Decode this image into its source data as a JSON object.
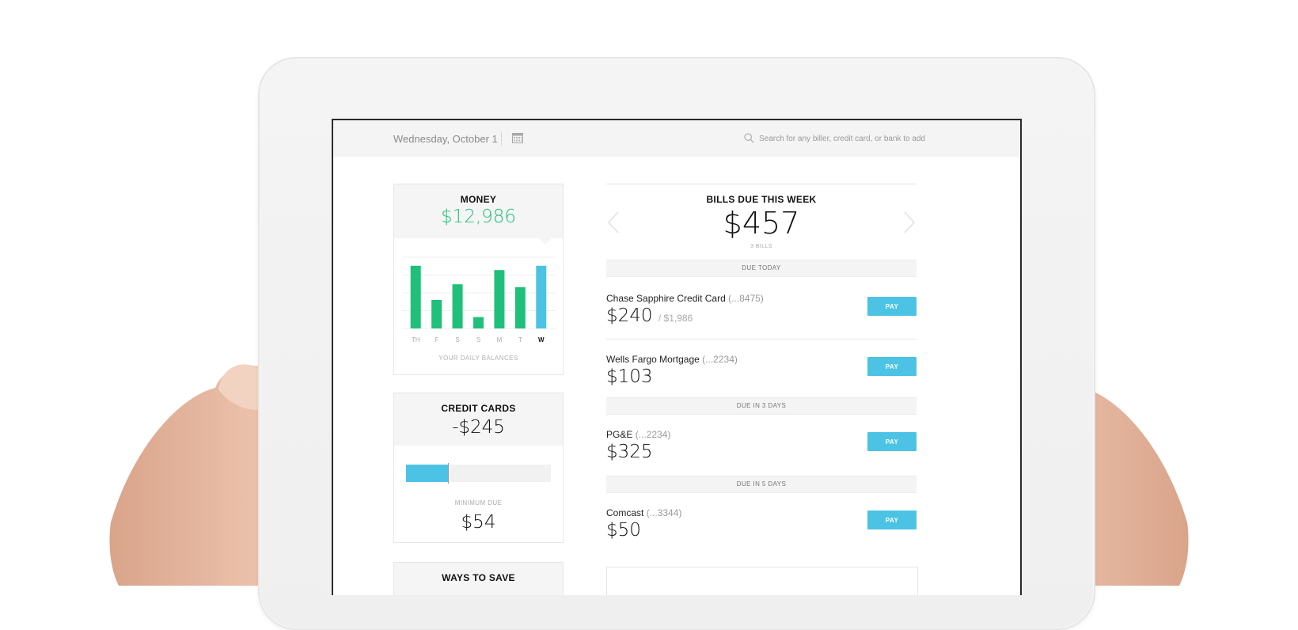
{
  "topbar": {
    "date": "Wednesday, October 1",
    "search_placeholder": "Search for any biller, credit card, or bank to add"
  },
  "money": {
    "title": "MONEY",
    "amount": "$12,986",
    "caption": "YOUR DAILY BALANCES"
  },
  "credit_cards": {
    "title": "CREDIT CARDS",
    "amount": "-$245",
    "min_due_label": "MINIMUM DUE",
    "min_due_amount": "$54",
    "progress_fraction": 0.29
  },
  "ways_to_save": {
    "title": "WAYS TO SAVE"
  },
  "bills": {
    "title": "BILLS DUE THIS WEEK",
    "total": "$457",
    "count": "3 BILLS",
    "sections": {
      "today": "DUE TODAY",
      "three_days": "DUE IN 3 DAYS",
      "five_days": "DUE IN 5 DAYS"
    },
    "items": [
      {
        "name": "Chase Sapphire Credit Card",
        "account": "(...8475)",
        "amount": "$240",
        "limit": "/ $1,986",
        "pay_label": "PAY"
      },
      {
        "name": "Wells Fargo Mortgage",
        "account": "(...2234)",
        "amount": "$103",
        "limit": "",
        "pay_label": "PAY"
      },
      {
        "name": "PG&E",
        "account": "(...2234)",
        "amount": "$325",
        "limit": "",
        "pay_label": "PAY"
      },
      {
        "name": "Comcast",
        "account": "(...3344)",
        "amount": "$50",
        "limit": "",
        "pay_label": "PAY"
      }
    ]
  },
  "colors": {
    "green": "#1fc07a",
    "blue": "#4cc3e4"
  },
  "chart_data": {
    "type": "bar",
    "categories": [
      "TH",
      "F",
      "S",
      "S",
      "M",
      "T",
      "W"
    ],
    "values": [
      88,
      40,
      62,
      16,
      82,
      58,
      88
    ],
    "ylim": [
      0,
      100
    ],
    "highlight_index": 6,
    "grid": true,
    "title": "",
    "xlabel": "YOUR DAILY BALANCES",
    "ylabel": ""
  }
}
